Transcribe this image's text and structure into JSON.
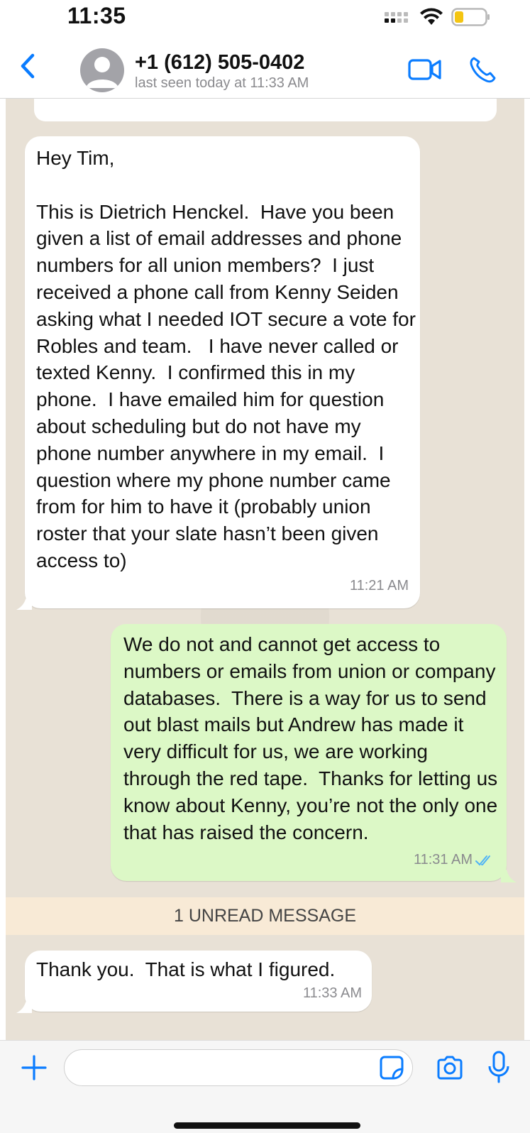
{
  "status_bar": {
    "time": "11:35"
  },
  "header": {
    "contact_name": "+1 (612) 505-0402",
    "contact_status": "last seen today at 11:33 AM"
  },
  "messages": [
    {
      "direction": "incoming",
      "text": "Hey Tim,\n\nThis is Dietrich Henckel.  Have you been given a list of email addresses and phone numbers for all union members?  I just received a phone call from Kenny Seiden  asking what I needed IOT secure a vote for Robles and team.   I have never called or texted Kenny.  I confirmed this in my phone.  I have emailed him for question about scheduling but do not have my phone number anywhere in my email.  I question where my phone number came from for him to have it (probably union roster that your slate hasn’t been given access to)",
      "time": "11:21 AM"
    },
    {
      "direction": "outgoing",
      "text": "We do not and cannot get access to numbers or emails from union or company databases.  There is a way for us to send out blast mails but Andrew has made it very difficult for us, we are working through the red tape.  Thanks for letting us know about Kenny, you’re not the only one that has raised the concern.",
      "time": "11:31 AM",
      "read_status": "read"
    },
    {
      "direction": "incoming",
      "text": "Thank you.  That is what I figured.",
      "time": "11:33 AM"
    }
  ],
  "unread_banner": "1 UNREAD MESSAGE",
  "composer": {
    "placeholder": ""
  },
  "colors": {
    "accent": "#0a7cff",
    "outgoing_bubble": "#dcf8c6",
    "incoming_bubble": "#ffffff",
    "unread_banner": "#f8ead6",
    "read_ticks": "#4fb3f6"
  },
  "icons": [
    "back-chevron-icon",
    "avatar-placeholder-icon",
    "video-call-icon",
    "phone-call-icon",
    "plus-icon",
    "sticker-icon",
    "camera-icon",
    "microphone-icon",
    "wifi-icon",
    "battery-icon",
    "cellular-signal-icon",
    "double-check-icon"
  ]
}
